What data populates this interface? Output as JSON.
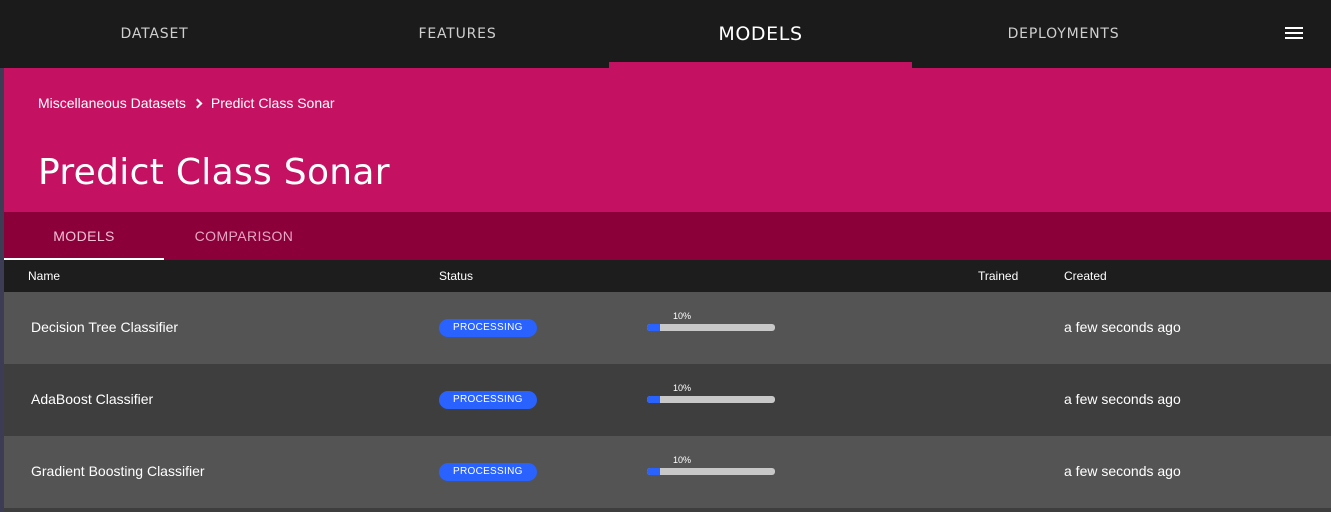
{
  "nav": {
    "items": [
      {
        "label": "DATASET"
      },
      {
        "label": "FEATURES"
      },
      {
        "label": "MODELS"
      },
      {
        "label": "DEPLOYMENTS"
      }
    ],
    "active": "MODELS",
    "menu_icon": "hamburger-menu-icon"
  },
  "header": {
    "breadcrumb": [
      "Miscellaneous Datasets",
      "Predict Class Sonar"
    ],
    "title": "Predict Class Sonar",
    "color": "#c51162"
  },
  "subtabs": {
    "items": [
      {
        "label": "MODELS"
      },
      {
        "label": "COMPARISON"
      }
    ],
    "active": "MODELS"
  },
  "table": {
    "columns": {
      "name": "Name",
      "status": "Status",
      "trained": "Trained",
      "created": "Created"
    },
    "rows": [
      {
        "name": "Decision Tree Classifier",
        "status": "PROCESSING",
        "progress_label": "10%",
        "progress": 0.1,
        "trained": "",
        "created": "a few seconds ago"
      },
      {
        "name": "AdaBoost Classifier",
        "status": "PROCESSING",
        "progress_label": "10%",
        "progress": 0.1,
        "trained": "",
        "created": "a few seconds ago"
      },
      {
        "name": "Gradient Boosting Classifier",
        "status": "PROCESSING",
        "progress_label": "10%",
        "progress": 0.1,
        "trained": "",
        "created": "a few seconds ago"
      }
    ]
  },
  "colors": {
    "accent": "#c51162",
    "accent_dark": "#8c003a",
    "status_processing": "#2962ff"
  }
}
